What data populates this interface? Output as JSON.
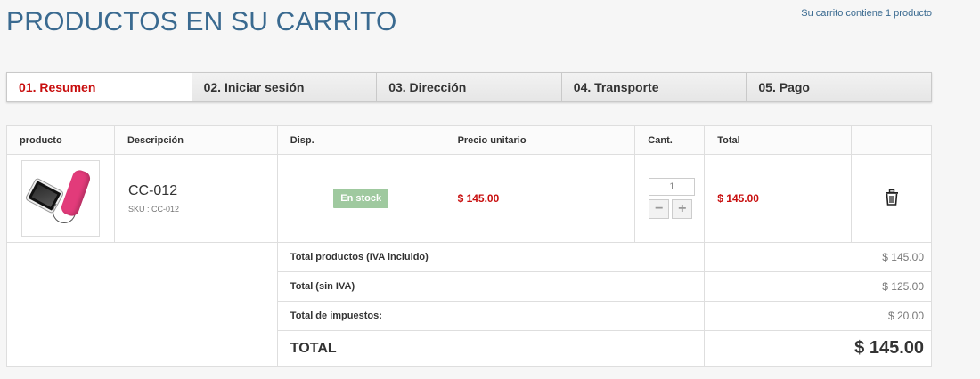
{
  "header": {
    "title": "PRODUCTOS EN SU CARRITO",
    "summary": "Su carrito contiene 1 producto"
  },
  "steps": [
    {
      "label": "01. Resumen",
      "active": true
    },
    {
      "label": "02. Iniciar sesión",
      "active": false
    },
    {
      "label": "03. Dirección",
      "active": false
    },
    {
      "label": "04. Transporte",
      "active": false
    },
    {
      "label": "05. Pago",
      "active": false
    }
  ],
  "table": {
    "headers": {
      "product": "producto",
      "description": "Descripción",
      "availability": "Disp.",
      "unit_price": "Precio unitario",
      "quantity": "Cant.",
      "total": "Total"
    },
    "item": {
      "name": "CC-012",
      "sku": "SKU : CC-012",
      "availability": "En stock",
      "unit_price": "$ 145.00",
      "quantity": "1",
      "total": "$ 145.00"
    },
    "summary": {
      "products_label": "Total productos (IVA incluido)",
      "products_value": "$ 145.00",
      "no_tax_label": "Total (sin IVA)",
      "no_tax_value": "$ 125.00",
      "tax_label": "Total de impuestos:",
      "tax_value": "$ 20.00",
      "total_label": "TOTAL",
      "total_value": "$ 145.00"
    }
  },
  "icons": {
    "delete": "trash-icon",
    "minus": "minus-icon",
    "plus": "plus-icon"
  },
  "colors": {
    "title": "#3a6a90",
    "accent_red": "#c80e0e",
    "stock_badge": "#9fc99f"
  }
}
